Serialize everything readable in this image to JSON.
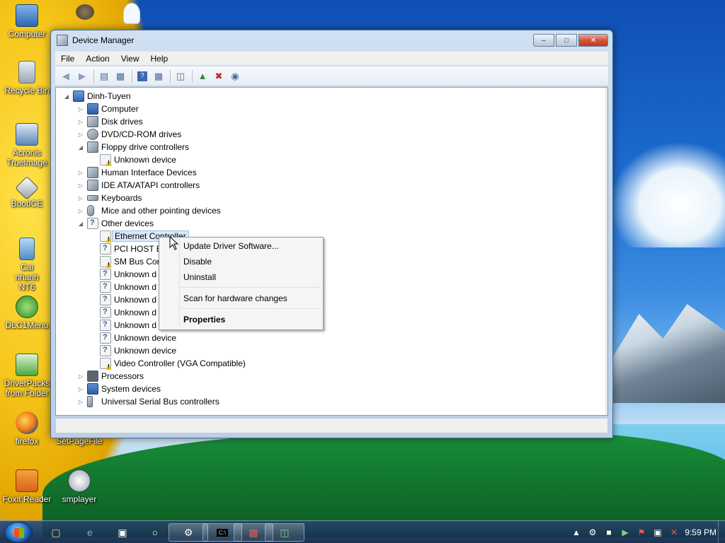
{
  "desktop": {
    "icons": [
      {
        "label": "Computer"
      },
      {
        "label": "Recycle Bin"
      },
      {
        "label": "Acronis TrueImage"
      },
      {
        "label": "BootICE"
      },
      {
        "label": "Cai nhanh NT6"
      },
      {
        "label": "DLC1Menu"
      },
      {
        "label": "DriverPacks from Folder"
      },
      {
        "label": "firefox"
      },
      {
        "label": "SetPageFile"
      },
      {
        "label": "Foxit Reader"
      },
      {
        "label": "smplayer"
      }
    ]
  },
  "window": {
    "title": "Device Manager",
    "menu": [
      "File",
      "Action",
      "View",
      "Help"
    ],
    "toolbar": [
      "back-icon",
      "forward-icon",
      "properties-icon",
      "tree-icon",
      "help-icon",
      "view-icon",
      "scan-icon",
      "update-driver-icon",
      "uninstall-icon",
      "disable-icon"
    ]
  },
  "tree": {
    "root": "Dinh-Tuyen",
    "nodes": [
      {
        "label": "Computer"
      },
      {
        "label": "Disk drives"
      },
      {
        "label": "DVD/CD-ROM drives"
      },
      {
        "label": "Floppy drive controllers"
      },
      {
        "label": "Unknown device"
      },
      {
        "label": "Human Interface Devices"
      },
      {
        "label": "IDE ATA/ATAPI controllers"
      },
      {
        "label": "Keyboards"
      },
      {
        "label": "Mice and other pointing devices"
      },
      {
        "label": "Other devices"
      },
      {
        "label": "Ethernet Controller"
      },
      {
        "label": "PCI HOST B"
      },
      {
        "label": "SM Bus Cor"
      },
      {
        "label": "Unknown d"
      },
      {
        "label": "Unknown d"
      },
      {
        "label": "Unknown d"
      },
      {
        "label": "Unknown d"
      },
      {
        "label": "Unknown d"
      },
      {
        "label": "Unknown device"
      },
      {
        "label": "Unknown device"
      },
      {
        "label": "Video Controller (VGA Compatible)"
      },
      {
        "label": "Processors"
      },
      {
        "label": "System devices"
      },
      {
        "label": "Universal Serial Bus controllers"
      }
    ]
  },
  "context_menu": {
    "items": [
      "Update Driver Software...",
      "Disable",
      "Uninstall",
      "Scan for hardware changes",
      "Properties"
    ]
  },
  "taskbar": {
    "clock": "9:59 PM"
  }
}
